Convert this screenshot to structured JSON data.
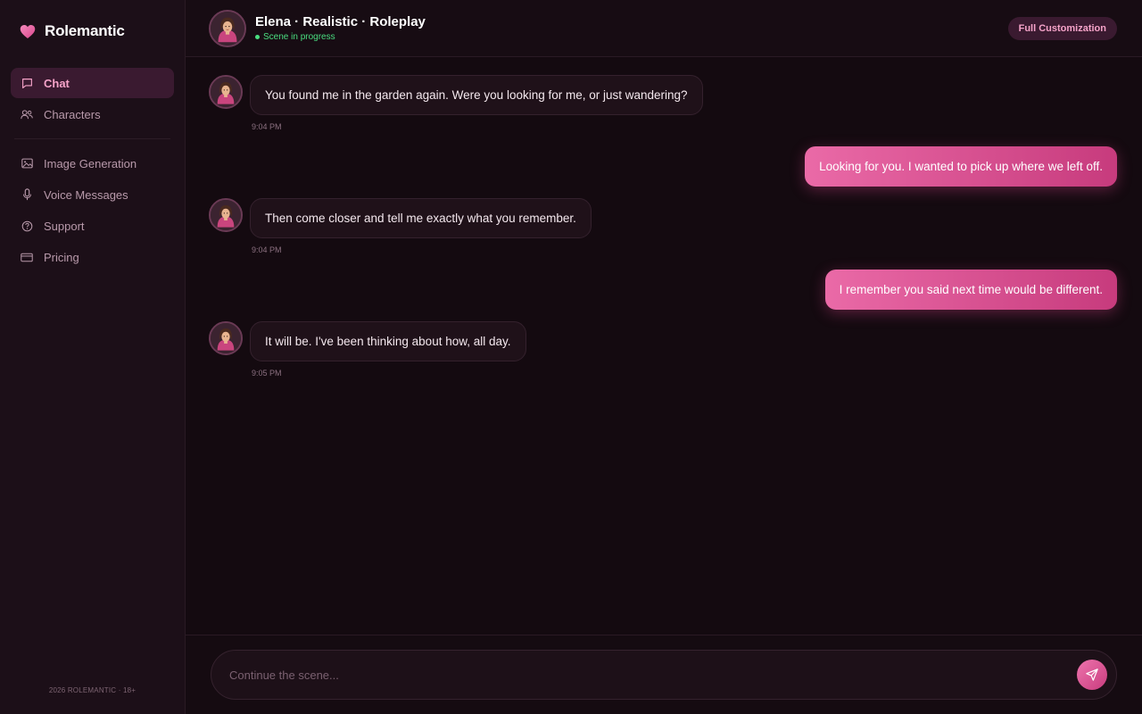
{
  "brand": {
    "name": "Rolemantic",
    "accent": "#e85c9e"
  },
  "sidebar": {
    "items": [
      {
        "label": "Chat",
        "icon": "chat-bubble-icon",
        "active": true
      },
      {
        "label": "Characters",
        "icon": "users-icon",
        "active": false
      }
    ],
    "items2": [
      {
        "label": "Image Generation",
        "icon": "image-icon"
      },
      {
        "label": "Voice Messages",
        "icon": "microphone-icon"
      },
      {
        "label": "Support",
        "icon": "help-circle-icon"
      },
      {
        "label": "Pricing",
        "icon": "credit-card-icon"
      }
    ],
    "footer": "2026 ROLEMANTIC · 18+"
  },
  "header": {
    "title": "Elena · Realistic · Roleplay",
    "status": "Scene in progress",
    "status_color": "#4ade80",
    "action_label": "Full Customization"
  },
  "messages": [
    {
      "sender": "bot",
      "text": "You found me in the garden again. Were you looking for me, or just wandering?",
      "time": "9:04 PM"
    },
    {
      "sender": "user",
      "text": "Looking for you. I wanted to pick up where we left off."
    },
    {
      "sender": "bot",
      "text": "Then come closer and tell me exactly what you remember.",
      "time": "9:04 PM"
    },
    {
      "sender": "user",
      "text": "I remember you said next time would be different."
    },
    {
      "sender": "bot",
      "text": "It will be. I've been thinking about how, all day.",
      "time": "9:05 PM"
    }
  ],
  "composer": {
    "placeholder": "Continue the scene...",
    "value": ""
  }
}
